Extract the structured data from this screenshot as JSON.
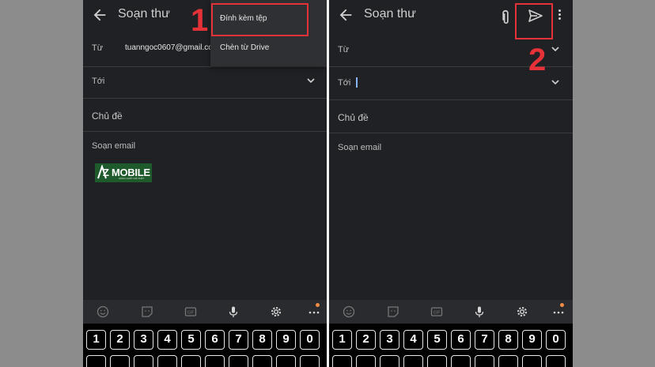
{
  "left_screen": {
    "title": "Soạn thư",
    "from_label": "Từ",
    "from_value": "tuanngoc0607@gmail.co",
    "to_label": "Tới",
    "subject_label": "Chủ đề",
    "body_placeholder": "Soạn email",
    "logo": {
      "text": "Z MOBILE",
      "tagline": "HÀNG CHẤT GIÁ THẬT"
    },
    "menu": [
      "Đính kèm tệp",
      "Chèn từ Drive"
    ],
    "step_number": "1"
  },
  "right_screen": {
    "title": "Soạn thư",
    "from_label": "Từ",
    "to_label": "Tới",
    "subject_label": "Chủ đề",
    "body_placeholder": "Soạn email",
    "step_number": "2"
  },
  "keyboard_keys": [
    "1",
    "2",
    "3",
    "4",
    "5",
    "6",
    "7",
    "8",
    "9",
    "0"
  ],
  "colors": {
    "background": "#202124",
    "highlight": "#e53238",
    "notification_dot": "#f28b46",
    "caret": "#8ab4f8"
  }
}
